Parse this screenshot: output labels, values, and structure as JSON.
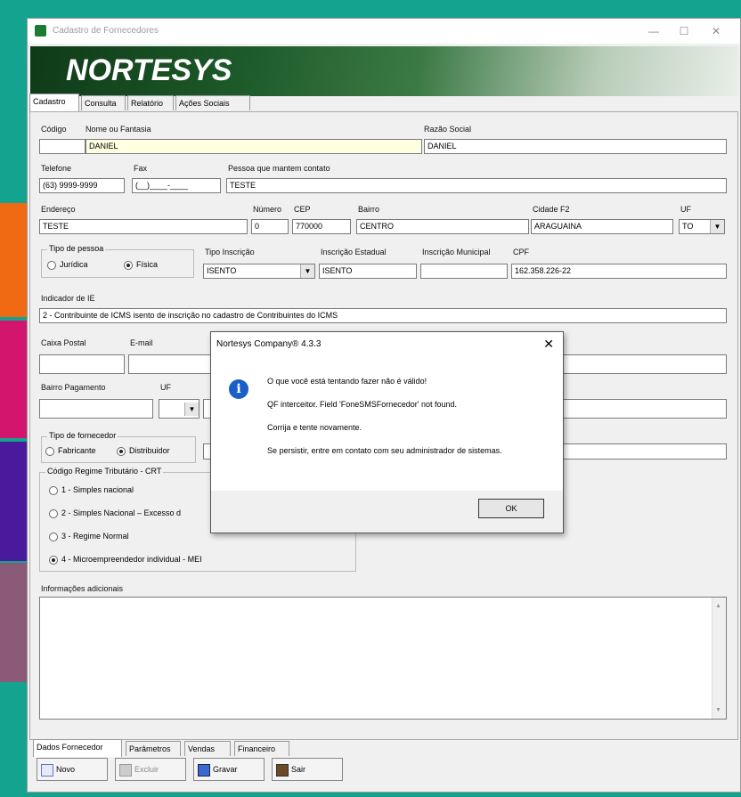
{
  "window": {
    "title": "Cadastro de Fornecedores",
    "logo_text": "NORTESYS",
    "minimize_label": "—",
    "maximize_label": "☐",
    "close_label": "✕"
  },
  "top_tabs": [
    "Cadastro",
    "Consulta",
    "Relatório",
    "Ações Sociais"
  ],
  "form": {
    "codigo_label": "Código",
    "codigo_value": "",
    "nome_label": "Nome ou Fantasia",
    "nome_value": "DANIEL",
    "razao_label": "Razão Social",
    "razao_value": "DANIEL",
    "telefone_label": "Telefone",
    "telefone_value": "(63) 9999-9999",
    "fax_label": "Fax",
    "fax_value": "(__)____-____",
    "contato_label": "Pessoa que mantem contato",
    "contato_value": "TESTE",
    "endereco_label": "Endereço",
    "endereco_value": "TESTE",
    "numero_label": "Número",
    "numero_value": "0",
    "cep_label": "CEP",
    "cep_value": "770000",
    "bairro_label": "Bairro",
    "bairro_value": "CENTRO",
    "cidade_label": "Cidade F2",
    "cidade_value": "ARAGUAINA",
    "uf_label": "UF",
    "uf_value": "TO",
    "tipo_pessoa_title": "Tipo de pessoa",
    "tipo_pessoa_juridica": "Jurídica",
    "tipo_pessoa_fisica": "Física",
    "tipo_inscricao_label": "Tipo Inscrição",
    "tipo_inscricao_value": "ISENTO",
    "ie_label": "Inscrição Estadual",
    "ie_value": "ISENTO",
    "im_label": "Inscrição Municipal",
    "im_value": "",
    "cpf_label": "CPF",
    "cpf_value": "162.358.226-22",
    "indicador_label": "Indicador de IE",
    "indicador_value": "2 - Contribuinte de ICMS isento de inscrição no cadastro de Contribuintes do ICMS",
    "caixa_postal_label": "Caixa Postal",
    "email_label": "E-mail",
    "bairro_pag_label": "Bairro Pagamento",
    "uf2_label": "UF",
    "tipo_fornecedor_title": "Tipo de fornecedor",
    "fabricante": "Fabricante",
    "distribuidor": "Distribuidor",
    "crt_title": "Código Regime Tributário - CRT",
    "crt_options": [
      "1 - Simples nacional",
      "2 - Simples Nacional – Excesso d",
      "3 - Regime Normal",
      "4 - Microempreendedor individual - MEI"
    ],
    "info_label": "Informações adicionais"
  },
  "bottom_tabs": [
    "Dados Fornecedor",
    "Parâmetros",
    "Vendas",
    "Financeiro"
  ],
  "buttons": {
    "novo": "Novo",
    "excluir": "Excluir",
    "gravar": "Gravar",
    "sair": "Sair"
  },
  "dialog": {
    "title": "Nortesys Company® 4.3.3",
    "line1": "O que você está tentando fazer não é válido!",
    "line2": "QF interceitor. Field 'FoneSMSFornecedor' not found.",
    "line3": "Corrija e tente novamente.",
    "line4": "Se persistir, entre em contato com seu administrador de sistemas.",
    "ok_label": "OK"
  }
}
